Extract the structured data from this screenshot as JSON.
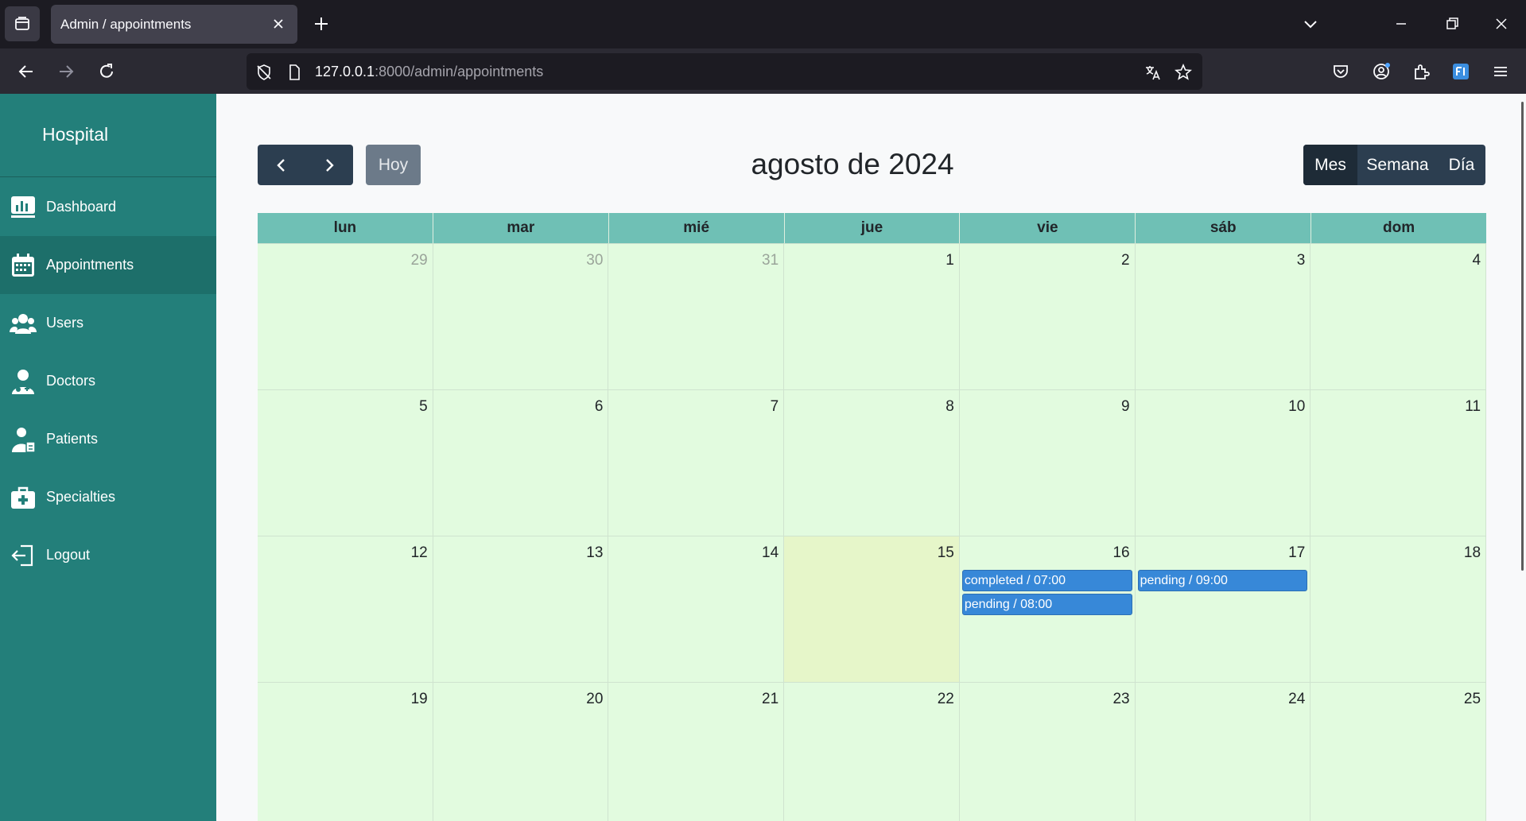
{
  "browser": {
    "tab_title": "Admin / appointments",
    "url_host": "127.0.0.1",
    "url_rest": ":8000/admin/appointments"
  },
  "sidebar": {
    "brand": "Hospital",
    "items": [
      {
        "label": "Dashboard",
        "icon": "chart-icon"
      },
      {
        "label": "Appointments",
        "icon": "calendar-icon",
        "active": true
      },
      {
        "label": "Users",
        "icon": "users-icon"
      },
      {
        "label": "Doctors",
        "icon": "doctor-icon"
      },
      {
        "label": "Patients",
        "icon": "patient-icon"
      },
      {
        "label": "Specialties",
        "icon": "medkit-icon"
      },
      {
        "label": "Logout",
        "icon": "logout-icon"
      }
    ]
  },
  "calendar": {
    "title": "agosto de 2024",
    "today_label": "Hoy",
    "views": [
      "Mes",
      "Semana",
      "Día"
    ],
    "active_view": "Mes",
    "weekdays": [
      "lun",
      "mar",
      "mié",
      "jue",
      "vie",
      "sáb",
      "dom"
    ],
    "weeks": [
      [
        {
          "day": "29",
          "other": true
        },
        {
          "day": "30",
          "other": true
        },
        {
          "day": "31",
          "other": true
        },
        {
          "day": "1"
        },
        {
          "day": "2"
        },
        {
          "day": "3"
        },
        {
          "day": "4"
        }
      ],
      [
        {
          "day": "5"
        },
        {
          "day": "6"
        },
        {
          "day": "7"
        },
        {
          "day": "8"
        },
        {
          "day": "9"
        },
        {
          "day": "10"
        },
        {
          "day": "11"
        }
      ],
      [
        {
          "day": "12"
        },
        {
          "day": "13"
        },
        {
          "day": "14"
        },
        {
          "day": "15",
          "today": true
        },
        {
          "day": "16",
          "events": [
            "completed / 07:00",
            "pending / 08:00"
          ]
        },
        {
          "day": "17",
          "events": [
            "pending / 09:00"
          ]
        },
        {
          "day": "18"
        }
      ],
      [
        {
          "day": "19"
        },
        {
          "day": "20"
        },
        {
          "day": "21"
        },
        {
          "day": "22"
        },
        {
          "day": "23"
        },
        {
          "day": "24"
        },
        {
          "day": "25"
        }
      ]
    ]
  },
  "colors": {
    "sidebar": "#237f7a",
    "header": "#6fc0b5",
    "cell": "#e2fbdf",
    "today": "#e6f6c9",
    "event": "#3788d8",
    "button": "#2c3e50"
  }
}
